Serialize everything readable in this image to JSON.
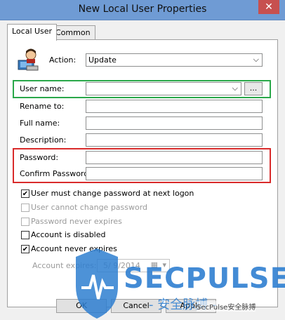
{
  "window": {
    "title": "New Local User Properties",
    "close_glyph": "✕"
  },
  "tabs": [
    {
      "label": "Local User"
    },
    {
      "label": "Common"
    }
  ],
  "form": {
    "action_label": "Action:",
    "action_value": "Update",
    "username_label": "User name:",
    "username_value": "",
    "browse_label": "...",
    "rename_label": "Rename to:",
    "fullname_label": "Full name:",
    "description_label": "Description:",
    "password_label": "Password:",
    "confirm_password_label": "Confirm Password:"
  },
  "checkboxes": [
    {
      "label": "User must change password at next logon",
      "checked": true,
      "disabled": false
    },
    {
      "label": "User cannot change password",
      "checked": false,
      "disabled": true
    },
    {
      "label": "Password never expires",
      "checked": false,
      "disabled": true
    },
    {
      "label": "Account is disabled",
      "checked": false,
      "disabled": false
    },
    {
      "label": "Account never expires",
      "checked": true,
      "disabled": false
    }
  ],
  "account_expires": {
    "label": "Account expires:",
    "value": "5/ 9/2014"
  },
  "buttons": {
    "ok": "OK",
    "cancel": "Cancel",
    "apply": "Apply"
  },
  "watermark": {
    "brand": "SECPULSE",
    "subtitle": "- 安全脉搏 -",
    "wechat": "SecPulse安全脉搏"
  },
  "colors": {
    "titlebar": "#6f9bd4",
    "highlight_green": "#2aa84a",
    "highlight_red": "#d92b2b",
    "watermark_blue": "#2f7fd1"
  }
}
